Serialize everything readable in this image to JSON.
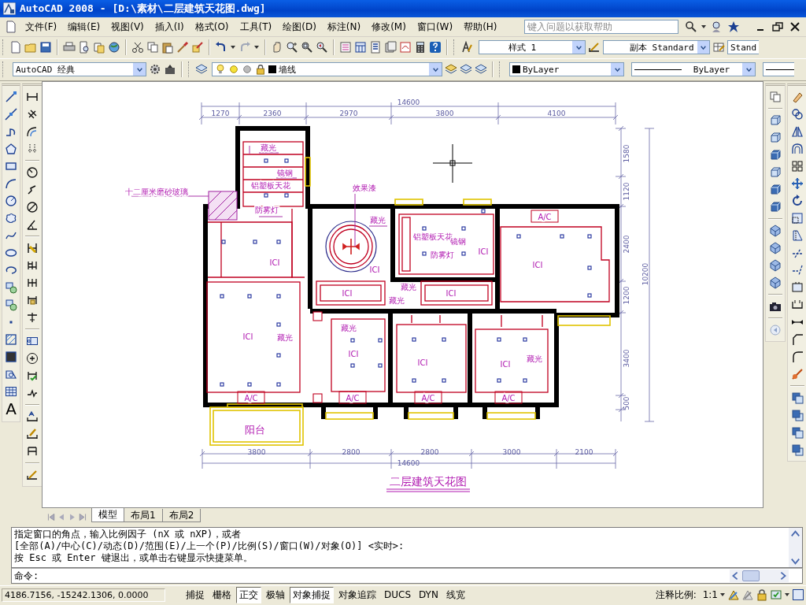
{
  "window": {
    "title": "AutoCAD 2008 - [D:\\素材\\二层建筑天花图.dwg]"
  },
  "menu": [
    "文件(F)",
    "编辑(E)",
    "视图(V)",
    "插入(I)",
    "格式(O)",
    "工具(T)",
    "绘图(D)",
    "标注(N)",
    "修改(M)",
    "窗口(W)",
    "帮助(H)"
  ],
  "help_search": {
    "placeholder": "键入问题以获取帮助"
  },
  "styles": {
    "text_style": "样式 1",
    "dimension_style": "副本 Standard",
    "table_style": "Stand"
  },
  "workspace": "AutoCAD 经典",
  "layer": "墙线",
  "color_control": "ByLayer",
  "linetype": "ByLayer",
  "draw_toolbar": {
    "text_tool": "A"
  },
  "drawing": {
    "title": "二层建筑天花图",
    "top_total": "14600",
    "top_dims": [
      "1270",
      "2360",
      "2970",
      "3800",
      "4100"
    ],
    "right_dims": [
      "1580",
      "1120",
      "2400",
      "1200",
      "3400",
      "500"
    ],
    "right_total": "10200",
    "bottom_dims": [
      "3800",
      "2800",
      "2800",
      "3000",
      "2100"
    ],
    "bottom_total": "14600",
    "labels": [
      "十二厘米磨砂玻璃",
      "藏光",
      "镜钢",
      "铝塑板天花",
      "防雾灯",
      "效果漆",
      "藏光",
      "ICI",
      "ICI",
      "铝塑板天花",
      "镜钢",
      "防雾灯",
      "ICI",
      "A/C",
      "ICI",
      "ICI",
      "藏光",
      "ICI",
      "藏光",
      "ICI",
      "藏光",
      "藏光",
      "ICI",
      "ICI",
      "ICI",
      "藏光",
      "A/C",
      "A/C",
      "A/C",
      "A/C",
      "阳台"
    ]
  },
  "layout_tabs": [
    {
      "label": "模型",
      "selected": true
    },
    {
      "label": "布局1",
      "selected": false
    },
    {
      "label": "布局2",
      "selected": false
    }
  ],
  "command": {
    "history": [
      "指定窗口的角点，输入比例因子 (nX 或 nXP)，或者",
      "[全部(A)/中心(C)/动态(D)/范围(E)/上一个(P)/比例(S)/窗口(W)/对象(O)] <实时>:",
      "按 Esc 或 Enter 键退出，或单击右键显示快捷菜单。"
    ],
    "prompt": "命令:"
  },
  "status_bar": {
    "coordinates": "4186.7156, -15242.1306, 0.0000",
    "toggles": [
      {
        "label": "捕捉",
        "on": false
      },
      {
        "label": "栅格",
        "on": false
      },
      {
        "label": "正交",
        "on": true
      },
      {
        "label": "极轴",
        "on": false
      },
      {
        "label": "对象捕捉",
        "on": true
      },
      {
        "label": "对象追踪",
        "on": false
      },
      {
        "label": "DUCS",
        "on": false
      },
      {
        "label": "DYN",
        "on": false
      },
      {
        "label": "线宽",
        "on": false
      }
    ],
    "annotation_scale_label": "注释比例:",
    "annotation_scale": "1:1"
  }
}
